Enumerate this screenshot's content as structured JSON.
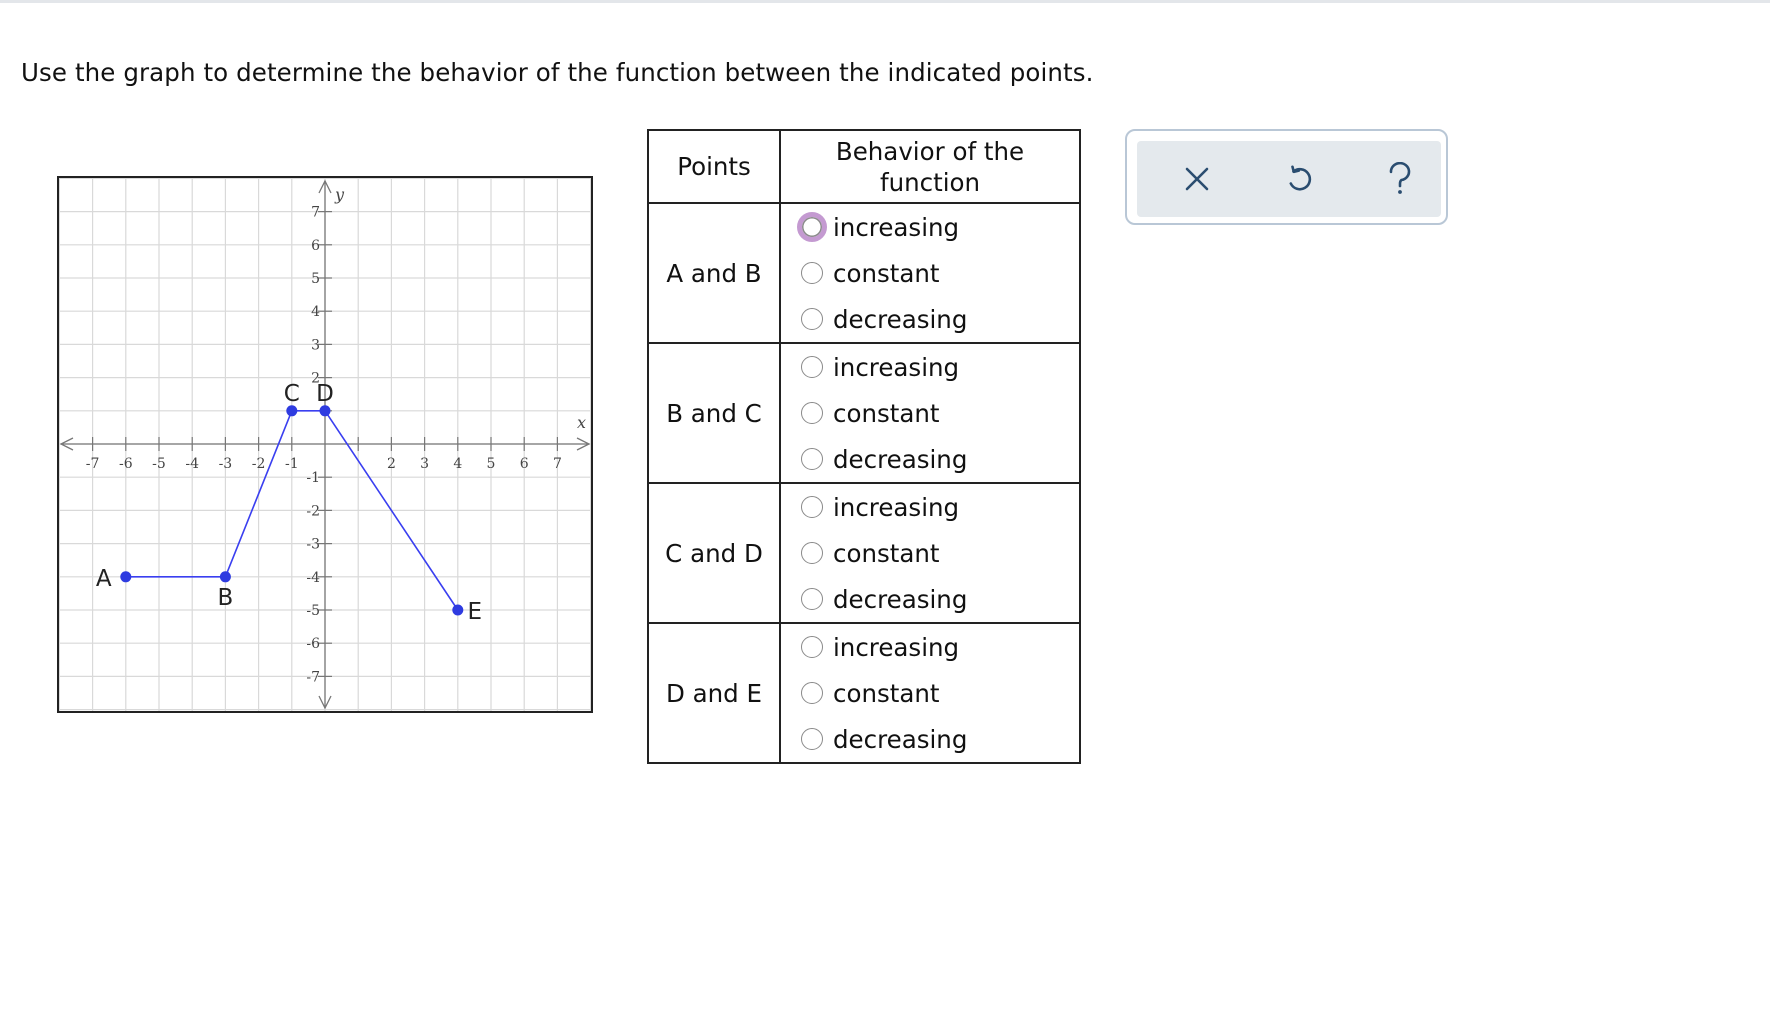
{
  "prompt": "Use the graph to determine the behavior of the function between the indicated points.",
  "graph": {
    "x_axis_label": "x",
    "y_axis_label": "y",
    "x_ticks": [
      "-7",
      "-6",
      "-5",
      "-4",
      "-3",
      "-2",
      "-1",
      "2",
      "3",
      "4",
      "5",
      "6",
      "7"
    ],
    "y_ticks": [
      "7",
      "6",
      "5",
      "4",
      "3",
      "2",
      "-1",
      "-2",
      "-3",
      "-4",
      "-5",
      "-6",
      "-7"
    ],
    "points": [
      {
        "label": "A",
        "x": -6,
        "y": -4
      },
      {
        "label": "B",
        "x": -3,
        "y": -4
      },
      {
        "label": "C",
        "x": -1,
        "y": 1
      },
      {
        "label": "D",
        "x": 0,
        "y": 1
      },
      {
        "label": "E",
        "x": 4,
        "y": -5
      }
    ],
    "line_color": "#3a3ff0",
    "point_color": "#2e3be0"
  },
  "table": {
    "header_points": "Points",
    "header_behavior": "Behavior of the function",
    "rows": [
      {
        "points": "A and B",
        "options": [
          "increasing",
          "constant",
          "decreasing"
        ]
      },
      {
        "points": "B and C",
        "options": [
          "increasing",
          "constant",
          "decreasing"
        ]
      },
      {
        "points": "C and D",
        "options": [
          "increasing",
          "constant",
          "decreasing"
        ]
      },
      {
        "points": "D and E",
        "options": [
          "increasing",
          "constant",
          "decreasing"
        ]
      }
    ]
  },
  "toolbar": {
    "buttons": [
      {
        "name": "clear",
        "icon": "close-icon"
      },
      {
        "name": "undo",
        "icon": "undo-icon"
      },
      {
        "name": "help",
        "icon": "help-icon"
      }
    ]
  },
  "colors": {
    "focus_ring": "#c49ad1",
    "toolbar_bg": "#e4e9ed",
    "toolbar_border": "#b9c7d6",
    "icon": "#2a4d70"
  }
}
